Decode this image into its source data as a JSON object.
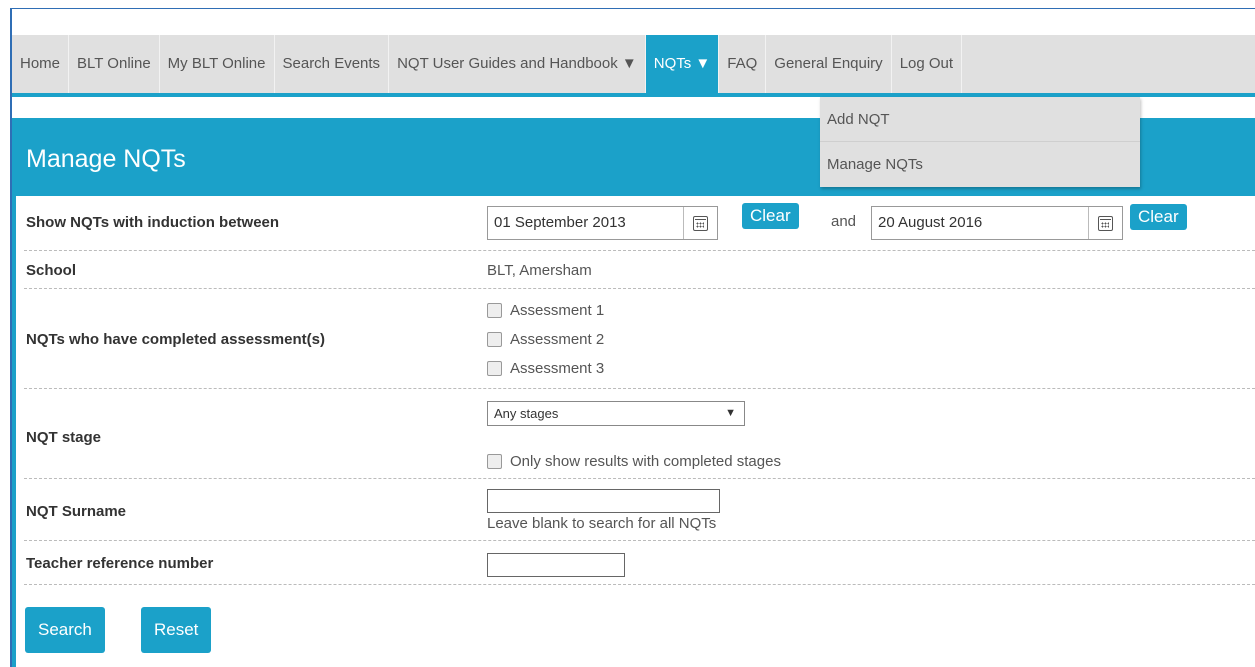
{
  "nav": {
    "items": [
      {
        "label": "Home"
      },
      {
        "label": "BLT Online"
      },
      {
        "label": "My BLT Online"
      },
      {
        "label": "Search Events"
      },
      {
        "label": "NQT User Guides and Handbook ▼"
      },
      {
        "label": "NQTs ▼"
      },
      {
        "label": "FAQ"
      },
      {
        "label": "General Enquiry"
      },
      {
        "label": "Log Out"
      }
    ],
    "dropdown": {
      "items": [
        {
          "label": "Add NQT"
        },
        {
          "label": "Manage NQTs"
        }
      ]
    }
  },
  "panel": {
    "title": "Manage NQTs"
  },
  "form": {
    "induction": {
      "label": "Show NQTs with induction between",
      "from_value": "01 September 2013",
      "clear_label": "Clear",
      "and_text": "and",
      "to_value": "20 August 2016",
      "clear2_label": "Clear"
    },
    "school": {
      "label": "School",
      "value": "BLT, Amersham"
    },
    "assessments": {
      "label": "NQTs who have completed assessment(s)",
      "options": [
        "Assessment 1",
        "Assessment 2",
        "Assessment 3"
      ]
    },
    "stage": {
      "label": "NQT stage",
      "selected": "Any stages",
      "checkbox_label": "Only show results with completed stages"
    },
    "surname": {
      "label": "NQT Surname",
      "value": "",
      "hint": "Leave blank to search for all NQTs"
    },
    "trn": {
      "label": "Teacher reference number",
      "value": ""
    }
  },
  "buttons": {
    "search": "Search",
    "reset": "Reset"
  },
  "colors": {
    "accent": "#1ba1c9",
    "nav_bg": "#e0e0e0",
    "frame": "#2f6eb5"
  }
}
